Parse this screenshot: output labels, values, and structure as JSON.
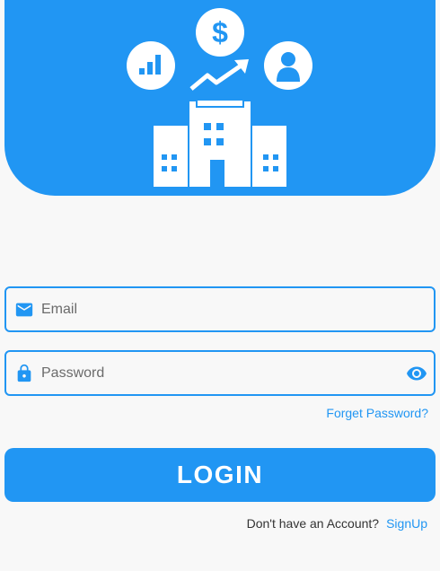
{
  "colors": {
    "primary": "#2196f3",
    "background": "#f8f8f8",
    "icon_white": "#ffffff"
  },
  "hero": {
    "icons": [
      "bar-chart-icon",
      "dollar-icon",
      "trend-up-arrow-icon",
      "user-icon",
      "office-building-icon"
    ]
  },
  "email": {
    "placeholder": "Email",
    "value": "",
    "icon": "mail-icon"
  },
  "password": {
    "placeholder": "Password",
    "value": "",
    "icon": "lock-icon",
    "toggle_icon": "eye-icon"
  },
  "forgot_label": "Forget Password?",
  "login_label": "LOGIN",
  "signup": {
    "prompt": "Don't have an Account?",
    "link_label": "SignUp"
  }
}
